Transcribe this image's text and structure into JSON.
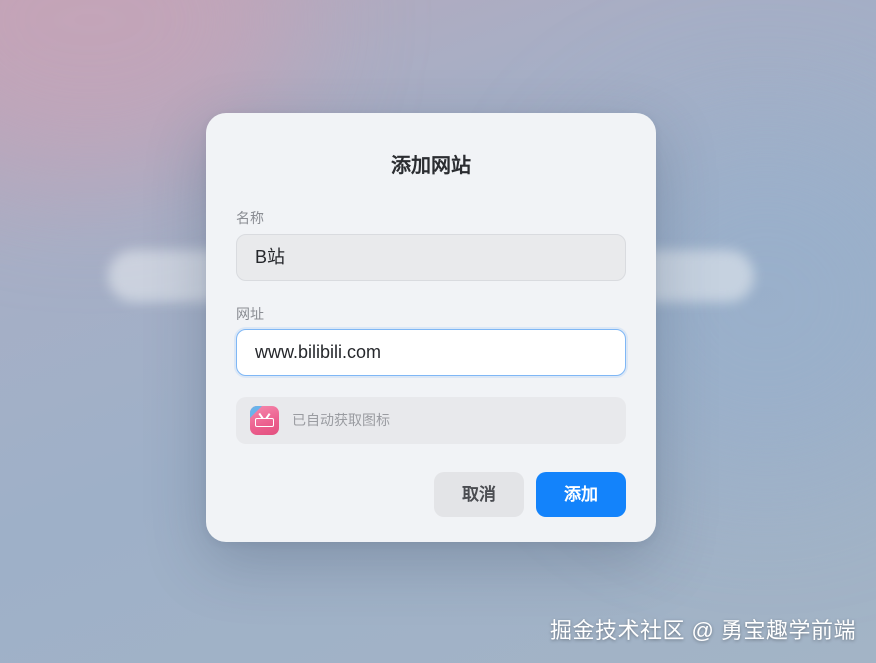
{
  "dialog": {
    "title": "添加网站",
    "name_label": "名称",
    "name_value": "B站",
    "url_label": "网址",
    "url_value": "www.bilibili.com",
    "icon_status": "已自动获取图标",
    "favicon": "bilibili-logo-icon",
    "cancel_label": "取消",
    "add_label": "添加"
  },
  "watermark": "掘金技术社区 @ 勇宝趣学前端",
  "colors": {
    "accent": "#1383fb",
    "dialog_bg": "#f1f3f6",
    "favicon_pink": "#ec5f8e"
  }
}
